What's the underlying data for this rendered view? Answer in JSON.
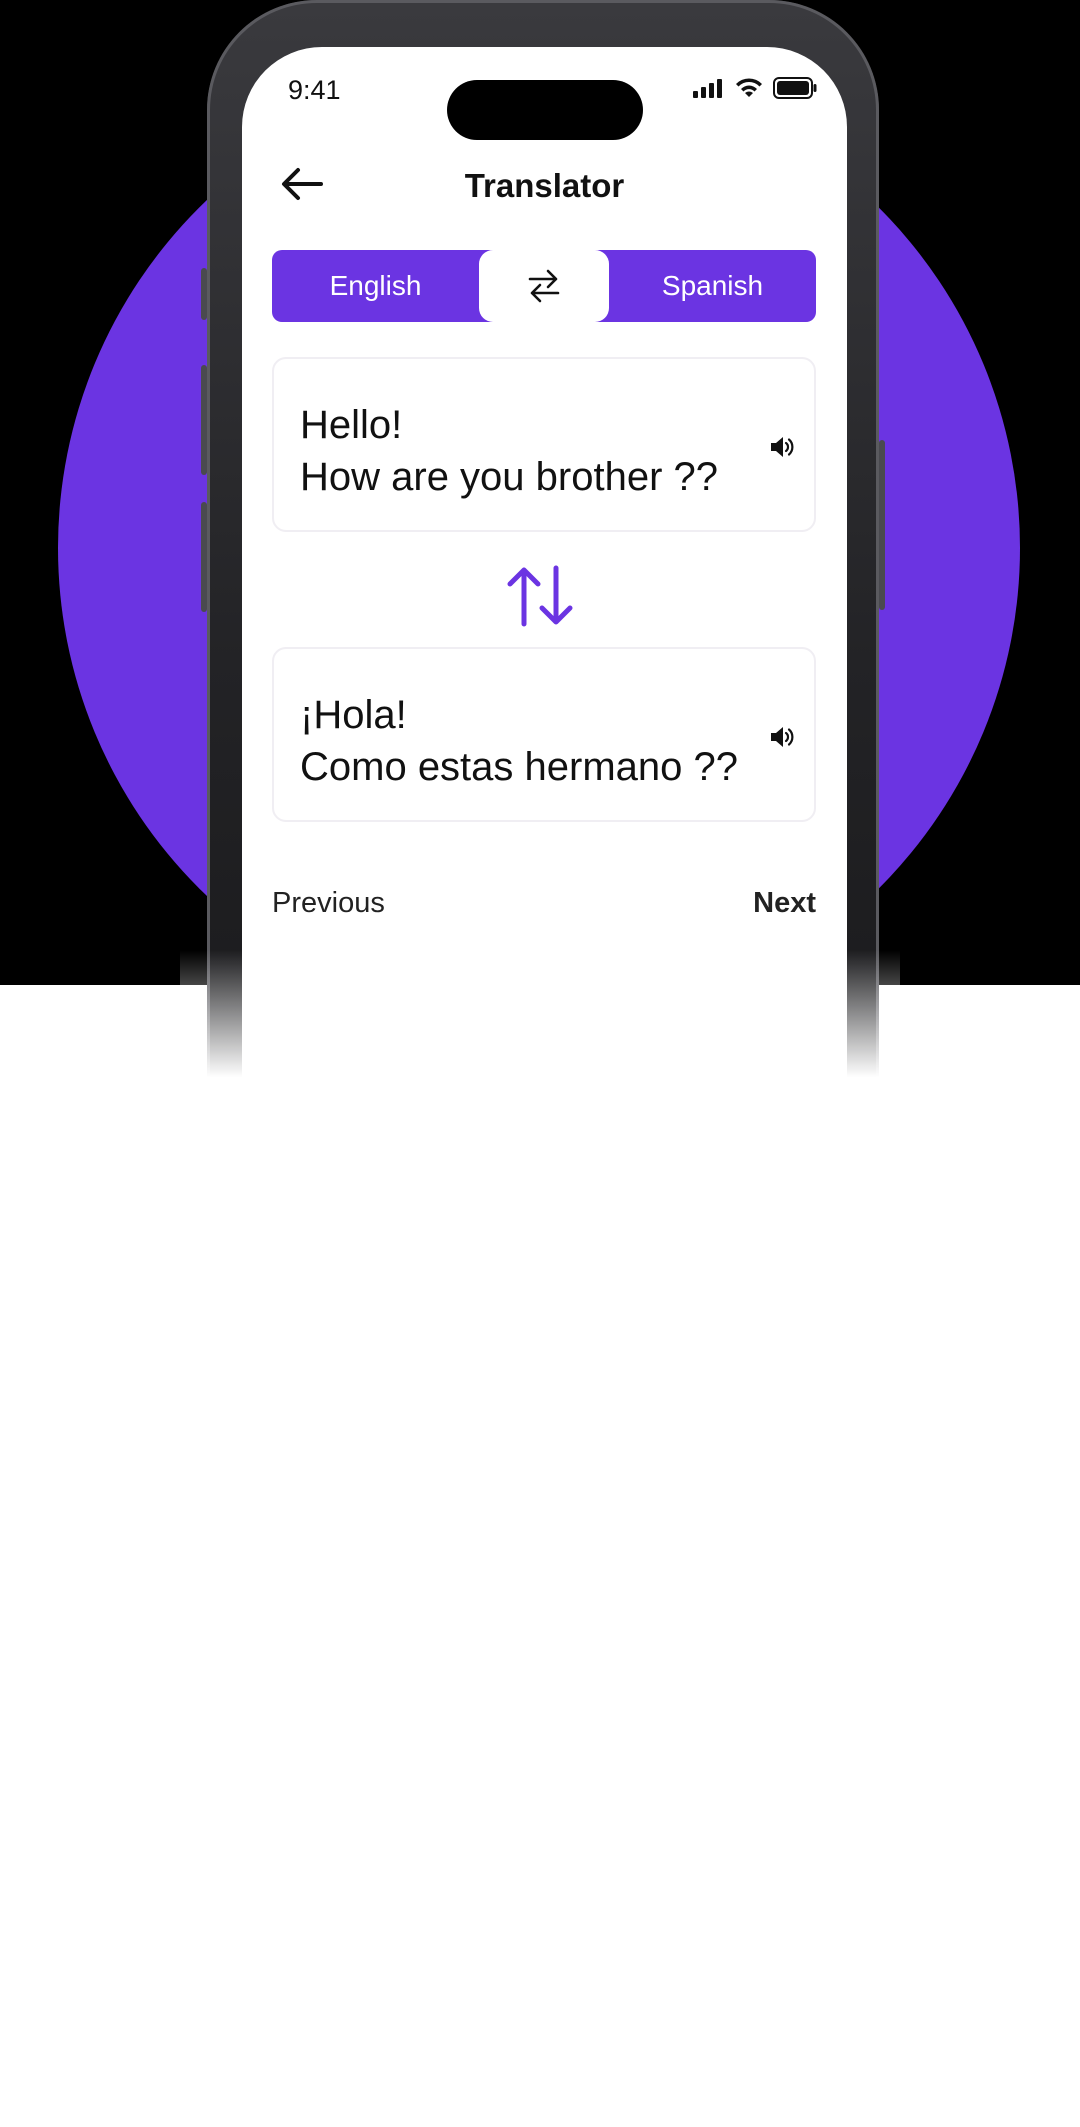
{
  "status": {
    "time": "9:41"
  },
  "header": {
    "title": "Translator"
  },
  "languages": {
    "source": "English",
    "target": "Spanish"
  },
  "source_card": {
    "text": "Hello!\nHow are you brother ??"
  },
  "target_card": {
    "text": "¡Hola!\nComo estas hermano ??"
  },
  "navigation": {
    "previous": "Previous",
    "next": "Next"
  },
  "colors": {
    "accent": "#6b34e2",
    "background_band": "#000000"
  },
  "icons": {
    "back": "arrow-left-icon",
    "swap": "swap-arrows-icon",
    "speaker": "speaker-icon",
    "translate_direction": "up-down-arrows-icon"
  }
}
